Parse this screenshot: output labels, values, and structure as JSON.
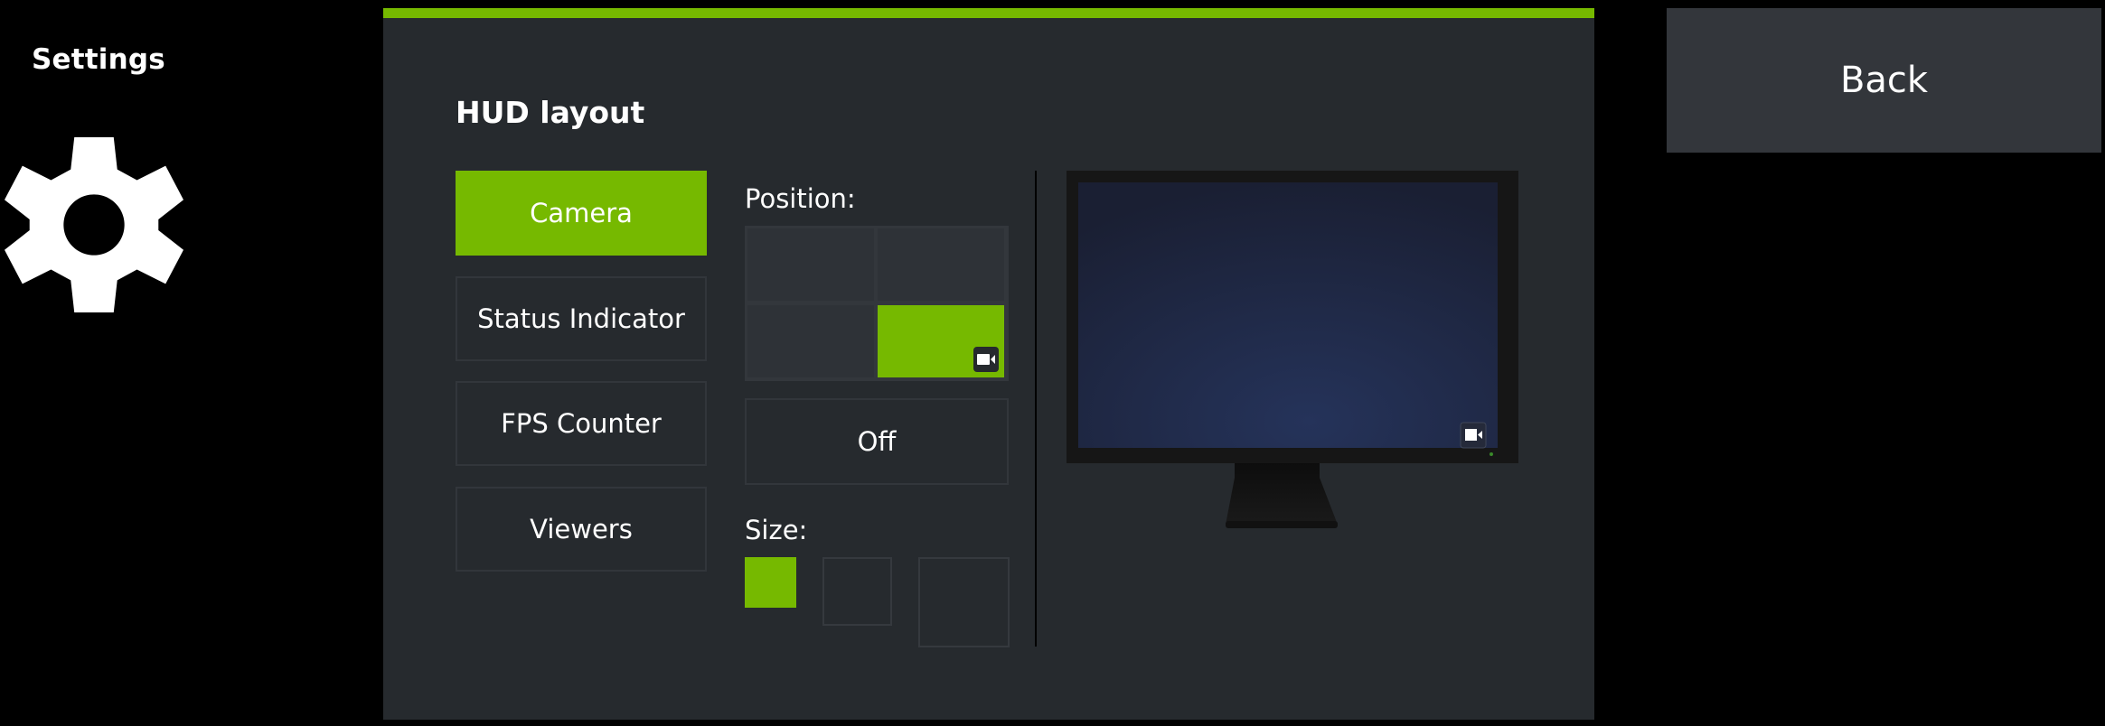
{
  "sidebar": {
    "title": "Settings",
    "icon": "gear-icon"
  },
  "panel": {
    "title": "HUD layout",
    "accent_color": "#76b900",
    "categories": [
      {
        "label": "Camera",
        "selected": true
      },
      {
        "label": "Status Indicator",
        "selected": false
      },
      {
        "label": "FPS Counter",
        "selected": false
      },
      {
        "label": "Viewers",
        "selected": false
      }
    ],
    "position": {
      "label": "Position:",
      "cells": [
        "top-left",
        "top-right",
        "bottom-left",
        "bottom-right"
      ],
      "selected": "bottom-right",
      "icon": "camera-icon",
      "off_label": "Off"
    },
    "size": {
      "label": "Size:",
      "options": [
        "small",
        "medium",
        "large"
      ],
      "selected": "small"
    },
    "preview": {
      "icon": "monitor-icon",
      "overlay_icon": "camera-icon"
    }
  },
  "back_button": {
    "label": "Back"
  }
}
